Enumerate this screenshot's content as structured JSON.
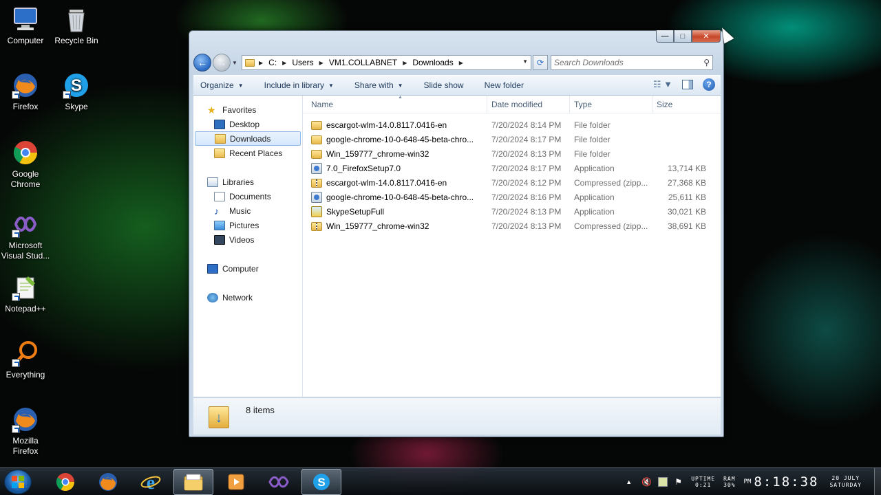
{
  "desktop": {
    "icons": [
      {
        "label": "Computer",
        "icon": "computer-icon"
      },
      {
        "label": "Recycle Bin",
        "icon": "recycle-bin-icon"
      },
      {
        "label": "Firefox",
        "icon": "firefox-icon"
      },
      {
        "label": "Skype",
        "icon": "skype-icon"
      },
      {
        "label": "Google Chrome",
        "icon": "chrome-icon"
      },
      {
        "label": "Microsoft Visual Stud...",
        "icon": "visual-studio-icon"
      },
      {
        "label": "Notepad++",
        "icon": "notepadpp-icon"
      },
      {
        "label": "Everything",
        "icon": "everything-icon"
      },
      {
        "label": "Mozilla Firefox",
        "icon": "firefox-icon"
      }
    ]
  },
  "window": {
    "caption_buttons": {
      "minimize": "—",
      "maximize": "□",
      "close": "✕"
    },
    "address": {
      "crumbs": [
        "C:",
        "Users",
        "VM1.COLLABNET",
        "Downloads"
      ]
    },
    "search": {
      "placeholder": "Search Downloads"
    },
    "toolbar": {
      "organize": "Organize",
      "include_in_library": "Include in library",
      "share_with": "Share with",
      "slide_show": "Slide show",
      "new_folder": "New folder"
    },
    "nav_pane": {
      "favorites": "Favorites",
      "desktop": "Desktop",
      "downloads": "Downloads",
      "recent_places": "Recent Places",
      "libraries": "Libraries",
      "documents": "Documents",
      "music": "Music",
      "pictures": "Pictures",
      "videos": "Videos",
      "computer": "Computer",
      "network": "Network"
    },
    "columns": {
      "name": "Name",
      "date": "Date modified",
      "type": "Type",
      "size": "Size"
    },
    "files": [
      {
        "name": "escargot-wlm-14.0.8117.0416-en",
        "date": "7/20/2024 8:14 PM",
        "type": "File folder",
        "size": "",
        "icon": "folder"
      },
      {
        "name": "google-chrome-10-0-648-45-beta-chro...",
        "date": "7/20/2024 8:17 PM",
        "type": "File folder",
        "size": "",
        "icon": "folder"
      },
      {
        "name": "Win_159777_chrome-win32",
        "date": "7/20/2024 8:13 PM",
        "type": "File folder",
        "size": "",
        "icon": "folder"
      },
      {
        "name": "7.0_FirefoxSetup7.0",
        "date": "7/20/2024 8:17 PM",
        "type": "Application",
        "size": "13,714 KB",
        "icon": "app"
      },
      {
        "name": "escargot-wlm-14.0.8117.0416-en",
        "date": "7/20/2024 8:12 PM",
        "type": "Compressed (zipp...",
        "size": "27,368 KB",
        "icon": "zip"
      },
      {
        "name": "google-chrome-10-0-648-45-beta-chro...",
        "date": "7/20/2024 8:16 PM",
        "type": "Application",
        "size": "25,611 KB",
        "icon": "app"
      },
      {
        "name": "SkypeSetupFull",
        "date": "7/20/2024 8:13 PM",
        "type": "Application",
        "size": "30,021 KB",
        "icon": "skype"
      },
      {
        "name": "Win_159777_chrome-win32",
        "date": "7/20/2024 8:13 PM",
        "type": "Compressed (zipp...",
        "size": "38,691 KB",
        "icon": "zip"
      }
    ],
    "status": {
      "items_count": "8 items"
    }
  },
  "taskbar": {
    "tray": {
      "uptime_label": "UPTIME",
      "uptime_value": "0:21",
      "ram_label": "RAM",
      "ram_value": "30%",
      "ampm": "PM",
      "time": "8:18:38",
      "date_line1": "20 JULY",
      "date_line2": "SATURDAY"
    }
  },
  "colors": {
    "accent": "#1e395b",
    "selection": "#d4e7fc",
    "close_button": "#c8472a"
  }
}
